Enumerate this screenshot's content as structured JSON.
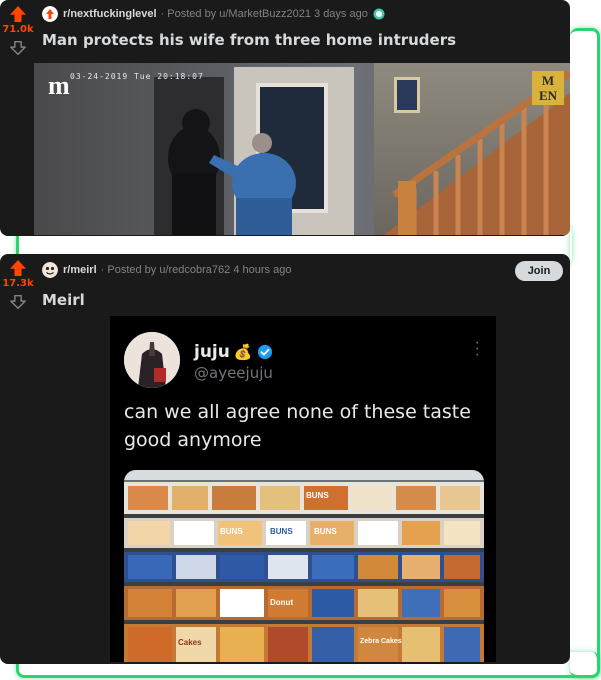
{
  "post1": {
    "subreddit": "r/nextfuckinglevel",
    "posted_by": "· Posted by u/MarketBuzz2021 3 days ago",
    "score": "71.0k",
    "title": "Man protects his wife from three home intruders",
    "video_timestamp": "03-24-2019 Tue 20:18:07",
    "video_logo": "m",
    "video_badge_top": "M",
    "video_badge_bottom": "EN"
  },
  "post2": {
    "subreddit": "r/meirl",
    "posted_by": "· Posted by u/redcobra762 4 hours ago",
    "score": "17.3k",
    "title": "Meirl",
    "join_label": "Join",
    "tweet": {
      "name": "juju",
      "name_emoji": "💰",
      "handle": "@ayeejuju",
      "text": "can we all agree none of these taste good anymore",
      "shelf_labels": [
        "BUNS",
        "BUNS",
        "BUNS",
        "BUNS",
        "Donut",
        "Cakes",
        "Zebra Cakes"
      ]
    }
  },
  "colors": {
    "accent_glow": "#2bd46f",
    "upvote": "#ff4500",
    "card_bg": "#1a1a1b",
    "verified": "#1d9bf0"
  },
  "icons": [
    "upvote-icon",
    "downvote-icon",
    "subreddit-avatar",
    "verified-badge-icon",
    "more-options-icon"
  ]
}
